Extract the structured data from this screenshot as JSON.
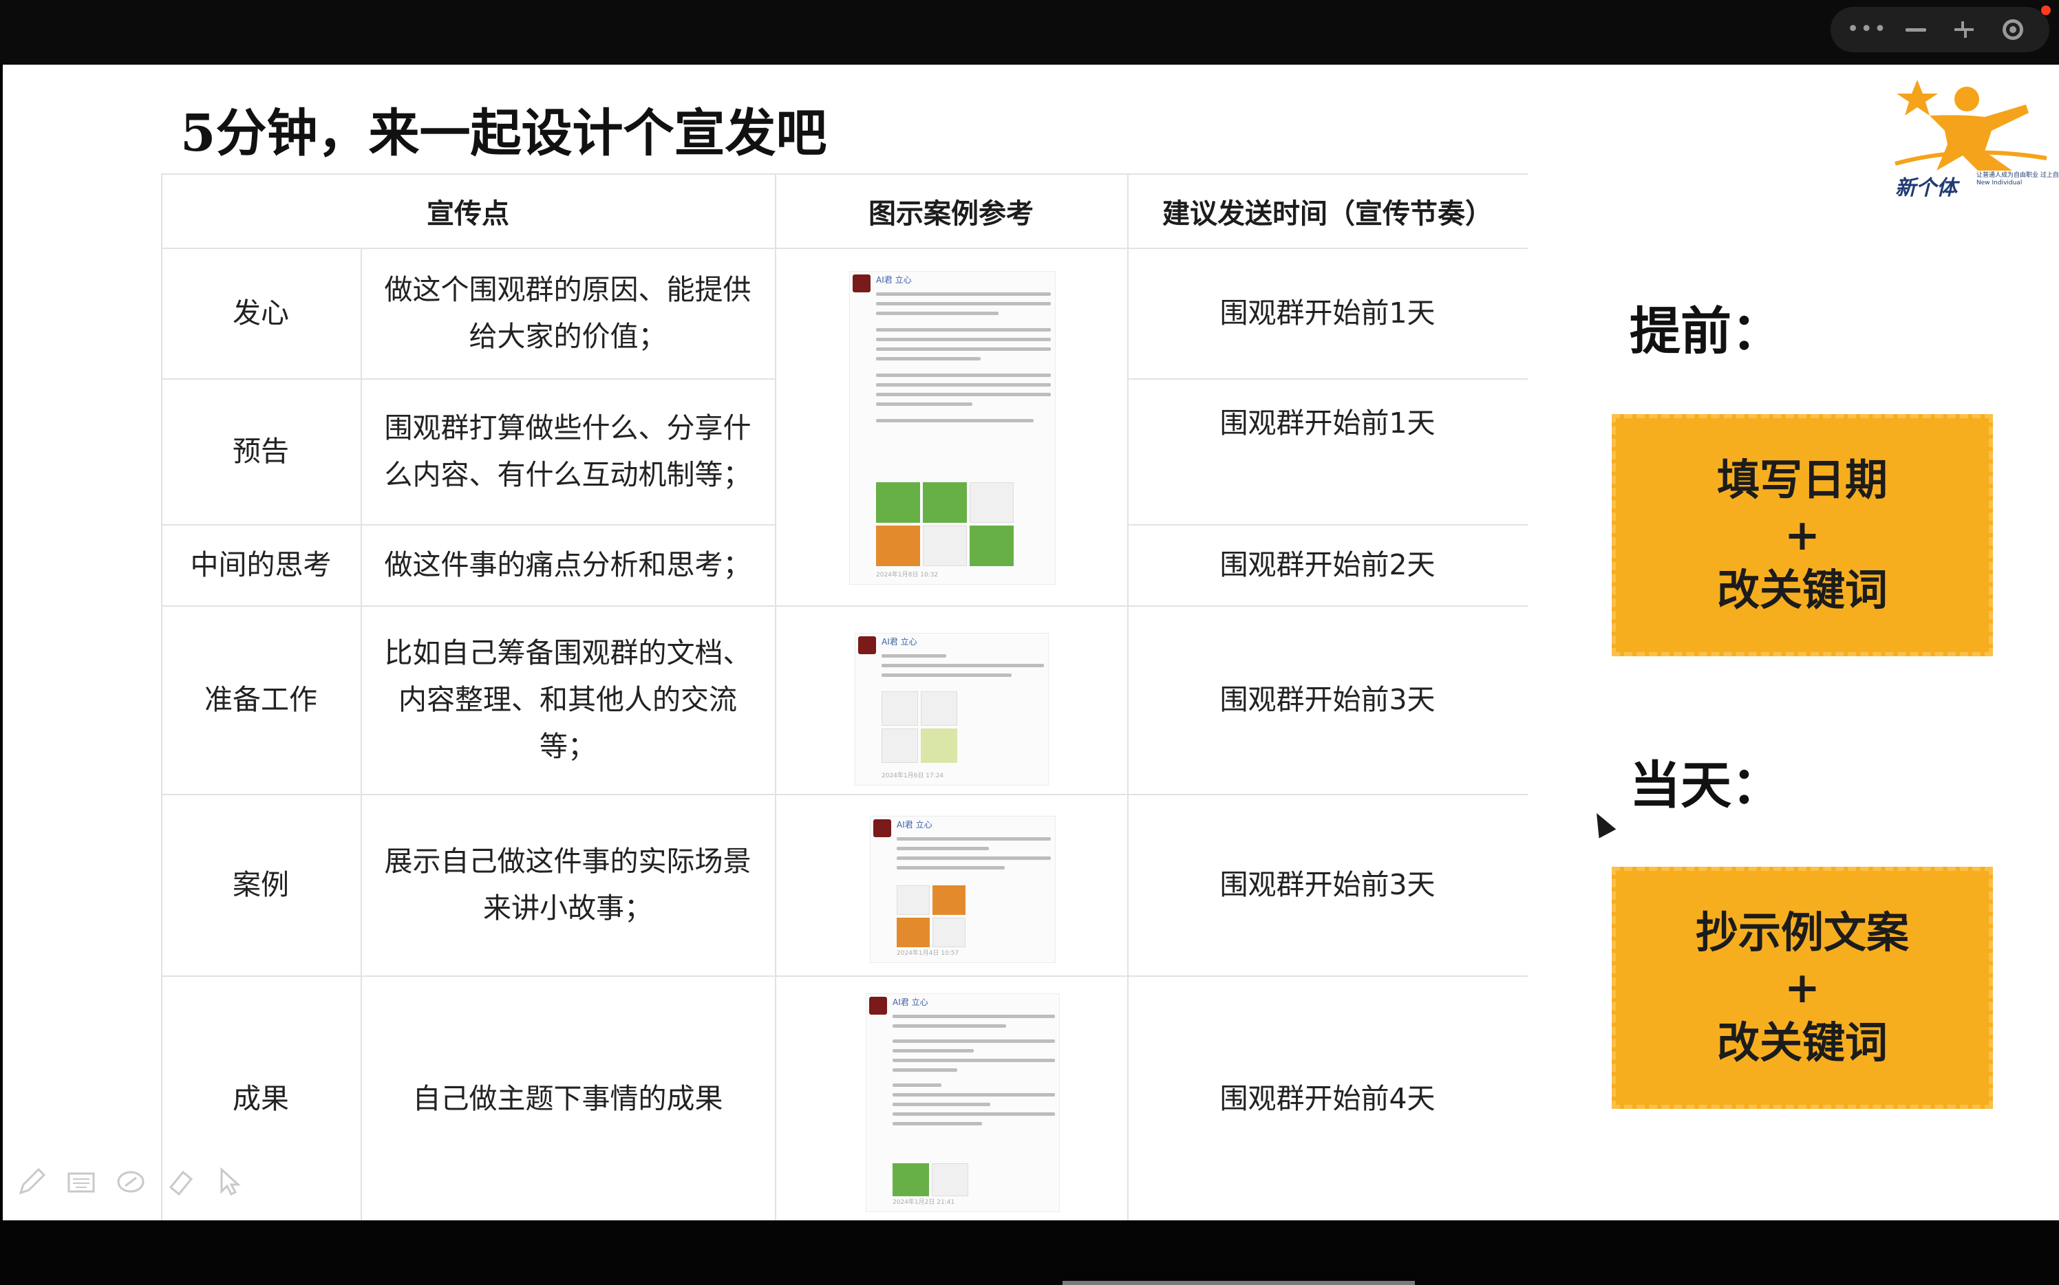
{
  "window_controls": {
    "icons": [
      "more-dots-icon",
      "minimize-icon",
      "exit-fullscreen-icon",
      "record-icon"
    ]
  },
  "slide": {
    "title": "5分钟，来一起设计个宣发吧",
    "logo": {
      "name": "新个体",
      "tagline": "让普通人成为自由职业 过上自由自在的好日子",
      "tagline_en": "New Individual"
    },
    "table": {
      "headers": [
        "宣传点",
        "图示案例参考",
        "建议发送时间（宣传节奏）"
      ],
      "rows": [
        {
          "point": "发心",
          "desc": "做这个围观群的原因、能提供给大家的价值；",
          "time": "围观群开始前1天"
        },
        {
          "point": "预告",
          "desc": "围观群打算做些什么、分享什么内容、有什么互动机制等；",
          "time": "围观群开始前1天"
        },
        {
          "point": "中间的思考",
          "desc": "做这件事的痛点分析和思考；",
          "time": "围观群开始前2天"
        },
        {
          "point": "准备工作",
          "desc": "比如自己筹备围观群的文档、内容整理、和其他人的交流等；",
          "time": "围观群开始前3天"
        },
        {
          "point": "案例",
          "desc": "展示自己做这件事的实际场景来讲小故事；",
          "time": "围观群开始前3天"
        },
        {
          "point": "成果",
          "desc": "自己做主题下事情的成果",
          "time": "围观群开始前4天"
        }
      ],
      "thumbnails": [
        {
          "author": "AI君 立心",
          "date": "2024年1月8日 10:32"
        },
        {
          "author": "AI君 立心",
          "date": "2024年1月6日 17:24"
        },
        {
          "author": "AI君 立心",
          "date": "2024年1月4日 10:57"
        },
        {
          "author": "AI君 立心",
          "date": "2024年1月2日 21:41"
        }
      ]
    },
    "side": {
      "before_label": "提前：",
      "before_box": [
        "填写日期",
        "+",
        "改关键词"
      ],
      "day_label": "当天：",
      "day_box": [
        "抄示例文案",
        "+",
        "改关键词"
      ]
    }
  },
  "draw_tools": [
    "pen-icon",
    "keyboard-icon",
    "eraser-icon",
    "highlighter-icon",
    "pointer-icon"
  ]
}
